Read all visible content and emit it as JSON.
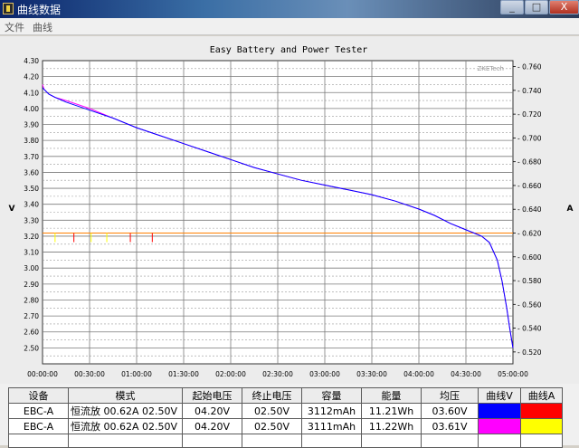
{
  "window": {
    "title": "曲线数据",
    "minimize": "_",
    "maximize": "□",
    "close": "X"
  },
  "menu": {
    "items": [
      "文件",
      "曲线"
    ]
  },
  "chart_data": {
    "type": "line",
    "title": "Easy Battery and Power Tester",
    "watermark": "ZKETech",
    "xlabel": "",
    "ylabel_left": "V",
    "ylabel_right": "A",
    "x_ticks": [
      "00:00:00",
      "00:30:00",
      "01:00:00",
      "01:30:00",
      "02:00:00",
      "02:30:00",
      "03:00:00",
      "03:30:00",
      "04:00:00",
      "04:30:00",
      "05:00:00"
    ],
    "xlim_minutes": [
      0,
      300
    ],
    "y_left_ticks": [
      "4.30",
      "4.20",
      "4.10",
      "4.00",
      "3.90",
      "3.80",
      "3.70",
      "3.60",
      "3.50",
      "3.40",
      "3.30",
      "3.20",
      "3.10",
      "3.00",
      "2.90",
      "2.80",
      "2.70",
      "2.60",
      "2.50"
    ],
    "ylim_left": [
      2.4,
      4.3
    ],
    "y_right_ticks": [
      "0.760",
      "0.740",
      "0.720",
      "0.700",
      "0.680",
      "0.660",
      "0.640",
      "0.620",
      "0.600",
      "0.580",
      "0.560",
      "0.540",
      "0.520"
    ],
    "ylim_right": [
      0.51,
      0.765
    ],
    "grid": true,
    "series": [
      {
        "axis": "left",
        "color": "#ff00ff",
        "x": [
          0,
          1,
          2,
          4,
          8,
          15,
          30,
          45,
          60,
          75,
          90,
          105,
          120,
          135,
          150,
          165,
          180,
          195,
          210,
          225,
          240,
          250,
          260,
          270,
          275,
          280,
          285,
          290,
          293,
          296,
          298,
          300
        ],
        "y": [
          4.15,
          4.12,
          4.11,
          4.09,
          4.07,
          4.05,
          4.0,
          3.94,
          3.88,
          3.83,
          3.78,
          3.73,
          3.68,
          3.63,
          3.59,
          3.55,
          3.52,
          3.49,
          3.46,
          3.42,
          3.37,
          3.33,
          3.28,
          3.24,
          3.22,
          3.2,
          3.16,
          3.05,
          2.92,
          2.75,
          2.62,
          2.5
        ]
      },
      {
        "axis": "left",
        "color": "#0000ff",
        "x": [
          0,
          1,
          2,
          4,
          8,
          15,
          30,
          45,
          60,
          75,
          90,
          105,
          120,
          135,
          150,
          165,
          180,
          195,
          210,
          225,
          240,
          250,
          260,
          270,
          275,
          280,
          285,
          290,
          293,
          296,
          298,
          300
        ],
        "y": [
          4.13,
          4.12,
          4.11,
          4.09,
          4.07,
          4.04,
          3.99,
          3.94,
          3.88,
          3.83,
          3.78,
          3.73,
          3.68,
          3.63,
          3.59,
          3.55,
          3.52,
          3.49,
          3.46,
          3.42,
          3.37,
          3.33,
          3.28,
          3.24,
          3.22,
          3.2,
          3.16,
          3.05,
          2.92,
          2.75,
          2.62,
          2.5
        ]
      },
      {
        "axis": "right",
        "color": "#ff0000",
        "x": [
          0,
          300
        ],
        "y": [
          0.62,
          0.62
        ]
      },
      {
        "axis": "right",
        "color": "#ffff00",
        "x": [
          0,
          300
        ],
        "y": [
          0.62,
          0.62
        ]
      }
    ]
  },
  "table": {
    "headers": [
      "设备",
      "模式",
      "起始电压",
      "终止电压",
      "容量",
      "能量",
      "均压",
      "曲线V",
      "曲线A"
    ],
    "rows": [
      {
        "device": "EBC-A",
        "mode": "恒流放  00.62A  02.50V",
        "start_v": "04.20V",
        "end_v": "02.50V",
        "capacity": "3112mAh",
        "energy": "11.21Wh",
        "avg_v": "03.60V",
        "curve_v_color": "#0000ff",
        "curve_a_color": "#ff0000"
      },
      {
        "device": "EBC-A",
        "mode": "恒流放  00.62A  02.50V",
        "start_v": "04.20V",
        "end_v": "02.50V",
        "capacity": "3111mAh",
        "energy": "11.22Wh",
        "avg_v": "03.61V",
        "curve_v_color": "#ff00ff",
        "curve_a_color": "#ffff00"
      }
    ]
  }
}
